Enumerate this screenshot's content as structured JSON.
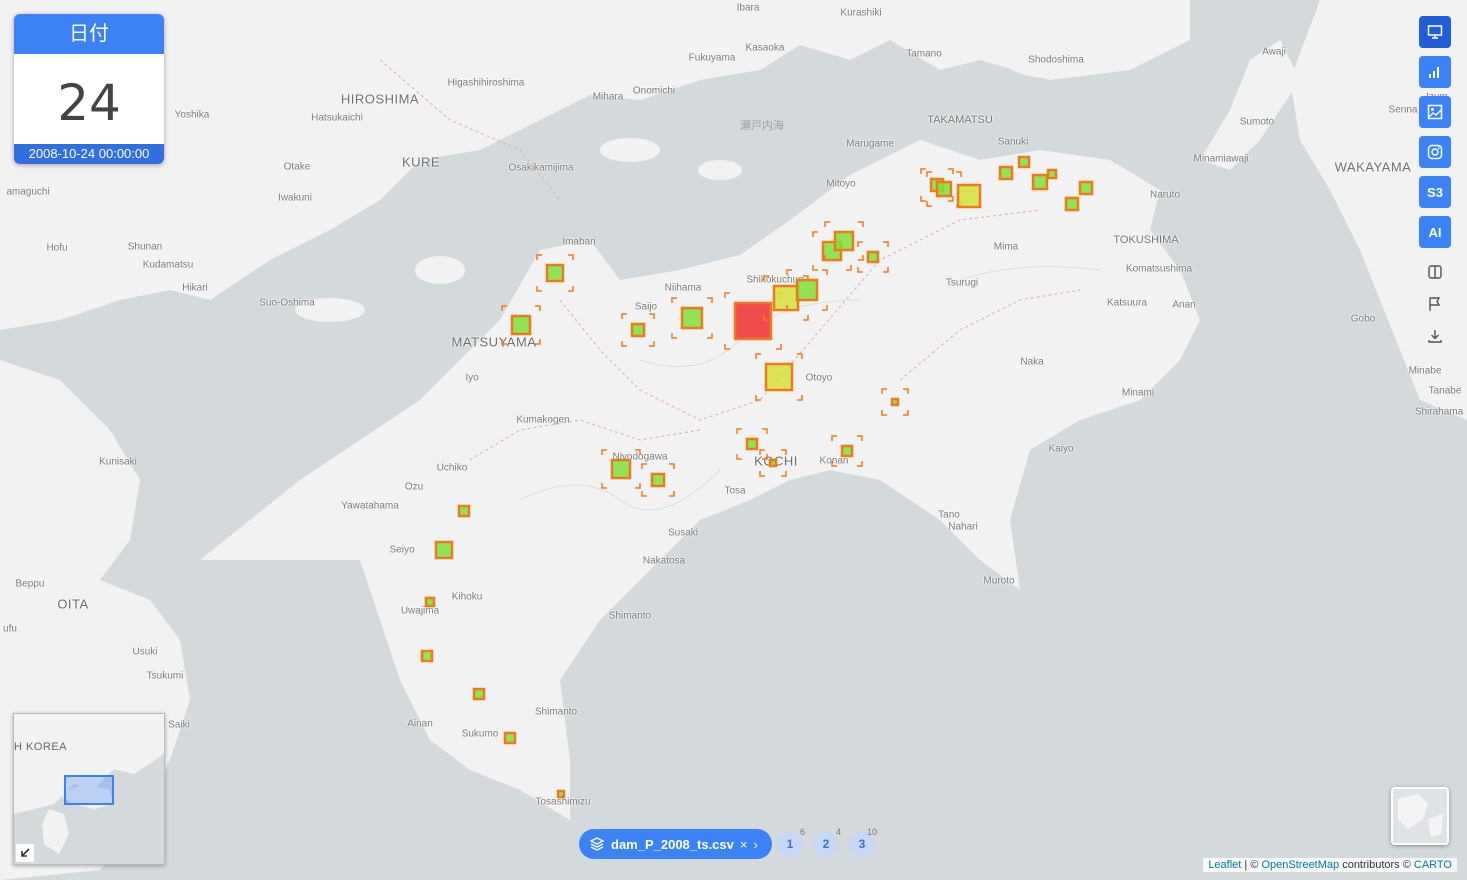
{
  "date_panel": {
    "header": "日付",
    "day": "24",
    "timestamp": "2008-10-24 00:00:00"
  },
  "toolbar": {
    "buttons": [
      {
        "name": "presentation-icon"
      },
      {
        "name": "bar-chart-icon"
      },
      {
        "name": "image-icon"
      },
      {
        "name": "instagram-icon"
      },
      {
        "name": "s3-button",
        "label": "S3"
      },
      {
        "name": "ai-button",
        "label": "AI"
      }
    ],
    "plain": [
      "split-view-icon",
      "flag-icon",
      "download-icon"
    ]
  },
  "layer_chip": {
    "label": "dam_P_2008_ts.csv"
  },
  "pages": [
    {
      "label": "1",
      "count": "6"
    },
    {
      "label": "2",
      "count": "4"
    },
    {
      "label": "3",
      "count": "10"
    }
  ],
  "attribution": {
    "leaflet": "Leaflet",
    "sep": " | © ",
    "osm": "OpenStreetMap",
    "mid": " contributors © ",
    "carto": "CARTO"
  },
  "minimap": {
    "label": "H KOREA"
  },
  "places": [
    {
      "t": "Ibara",
      "c": "place"
    },
    {
      "t": "Kurashiki",
      "c": "place"
    },
    {
      "t": "Kasaoka",
      "c": "place"
    },
    {
      "t": "Fukuyama",
      "c": "place"
    },
    {
      "t": "Tamano",
      "c": "place"
    },
    {
      "t": "Shodoshima",
      "c": "place"
    },
    {
      "t": "Awaji",
      "c": "place"
    },
    {
      "t": "Higashihiroshima",
      "c": "place"
    },
    {
      "t": "HIROSHIMA",
      "c": "place big"
    },
    {
      "t": "Mihara",
      "c": "place"
    },
    {
      "t": "Onomichi",
      "c": "place"
    },
    {
      "t": "Yoshika",
      "c": "place"
    },
    {
      "t": "Hatsukaichi",
      "c": "place"
    },
    {
      "t": "瀬戸内海",
      "c": "place sea"
    },
    {
      "t": "TAKAMATSU",
      "c": "place mid"
    },
    {
      "t": "Sumoto",
      "c": "place"
    },
    {
      "t": "Marugame",
      "c": "place"
    },
    {
      "t": "Sanuki",
      "c": "place"
    },
    {
      "t": "Minamiawaji",
      "c": "place"
    },
    {
      "t": "WAKAYAMA",
      "c": "place big"
    },
    {
      "t": "KURE",
      "c": "place big"
    },
    {
      "t": "Otake",
      "c": "place"
    },
    {
      "t": "Osakikamijima",
      "c": "place"
    },
    {
      "t": "Mitoyo",
      "c": "place"
    },
    {
      "t": "Naruto",
      "c": "place"
    },
    {
      "t": "Iwakuni",
      "c": "place"
    },
    {
      "t": "amaguchi",
      "c": "place"
    },
    {
      "t": "Imabari",
      "c": "place"
    },
    {
      "t": "Mima",
      "c": "place"
    },
    {
      "t": "TOKUSHIMA",
      "c": "place mid"
    },
    {
      "t": "Hofu",
      "c": "place"
    },
    {
      "t": "Shunan",
      "c": "place"
    },
    {
      "t": "Kudamatsu",
      "c": "place"
    },
    {
      "t": "Komatsushima",
      "c": "place"
    },
    {
      "t": "Hikari",
      "c": "place"
    },
    {
      "t": "Niihama",
      "c": "place"
    },
    {
      "t": "Shikokuchuo",
      "c": "place"
    },
    {
      "t": "Tsurugi",
      "c": "place"
    },
    {
      "t": "Suo-Oshima",
      "c": "place"
    },
    {
      "t": "Saijo",
      "c": "place"
    },
    {
      "t": "Katsuura",
      "c": "place"
    },
    {
      "t": "Anan",
      "c": "place"
    },
    {
      "t": "Gobo",
      "c": "place"
    },
    {
      "t": "MATSUYAMA",
      "c": "place big"
    },
    {
      "t": "Iyo",
      "c": "place"
    },
    {
      "t": "Naka",
      "c": "place"
    },
    {
      "t": "Otoyo",
      "c": "place"
    },
    {
      "t": "Minabe",
      "c": "place"
    },
    {
      "t": "Minami",
      "c": "place"
    },
    {
      "t": "Tanabe",
      "c": "place"
    },
    {
      "t": "Shirahama",
      "c": "place"
    },
    {
      "t": "Kumakogen",
      "c": "place"
    },
    {
      "t": "Kaiyo",
      "c": "place"
    },
    {
      "t": "Kunisaki",
      "c": "place"
    },
    {
      "t": "Niyodogawa",
      "c": "place"
    },
    {
      "t": "KOCHI",
      "c": "place big"
    },
    {
      "t": "Konan",
      "c": "place"
    },
    {
      "t": "Uchiko",
      "c": "place"
    },
    {
      "t": "Tosa",
      "c": "place"
    },
    {
      "t": "Ozu",
      "c": "place"
    },
    {
      "t": "Yawatahama",
      "c": "place"
    },
    {
      "t": "Tano",
      "c": "place"
    },
    {
      "t": "Nahari",
      "c": "place"
    },
    {
      "t": "Susaki",
      "c": "place"
    },
    {
      "t": "Seiyo",
      "c": "place"
    },
    {
      "t": "Nakatosa",
      "c": "place"
    },
    {
      "t": "Muroto",
      "c": "place"
    },
    {
      "t": "Beppu",
      "c": "place"
    },
    {
      "t": "Kihoku",
      "c": "place"
    },
    {
      "t": "OITA",
      "c": "place big"
    },
    {
      "t": "Uwajima",
      "c": "place"
    },
    {
      "t": "Shimanto",
      "c": "place"
    },
    {
      "t": "ufu",
      "c": "place"
    },
    {
      "t": "Usuki",
      "c": "place"
    },
    {
      "t": "Tsukumi",
      "c": "place"
    },
    {
      "t": "Saiki",
      "c": "place"
    },
    {
      "t": "Shimanto",
      "c": "place"
    },
    {
      "t": "Ainan",
      "c": "place"
    },
    {
      "t": "Sukumo",
      "c": "place"
    },
    {
      "t": "Tosashimizu",
      "c": "place"
    },
    {
      "t": "Izum",
      "c": "place"
    },
    {
      "t": "Senna",
      "c": "place"
    }
  ],
  "colors": {
    "accent": "#3b82f6",
    "marker_stroke": "#f07a1a",
    "low": "#7ee03a",
    "mid": "#d6e03a",
    "high": "#f03a3a"
  }
}
